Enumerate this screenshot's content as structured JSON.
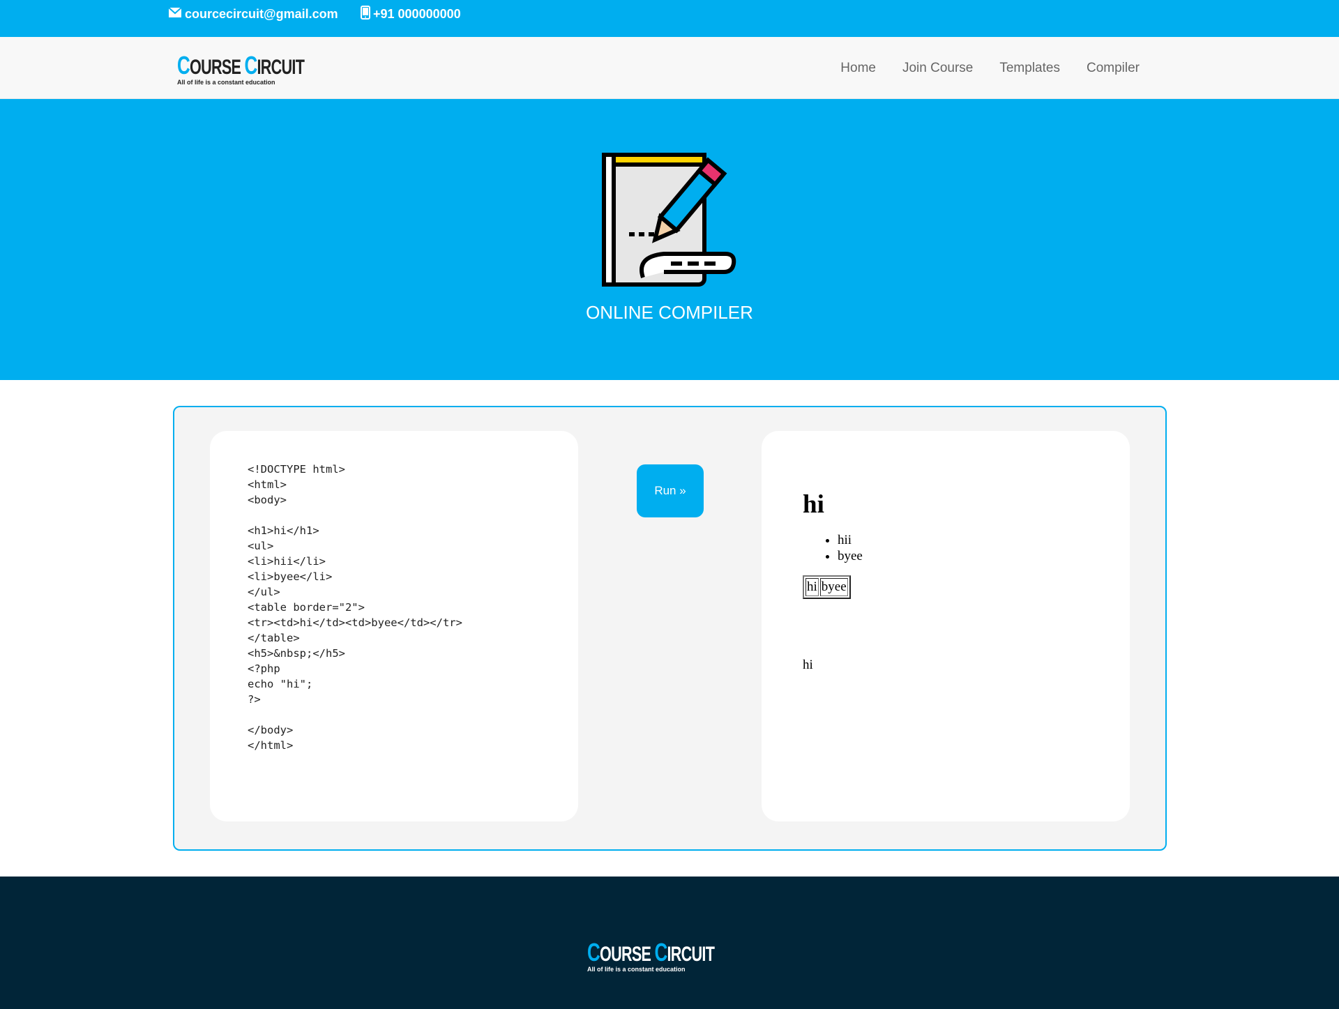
{
  "topbar": {
    "email": "courcecircuit@gmail.com",
    "phone": "+91 000000000",
    "email_icon": "envelope-icon",
    "phone_icon": "mobile-phone-icon"
  },
  "brand": {
    "title_c1": "C",
    "title_rest1": "OURSE ",
    "title_c2": "C",
    "title_rest2": "IRCUIT",
    "tagline": "All of life is a constant education"
  },
  "nav": {
    "items": [
      {
        "label": "Home"
      },
      {
        "label": "Join Course"
      },
      {
        "label": "Templates"
      },
      {
        "label": "Compiler"
      }
    ]
  },
  "hero": {
    "title": "ONLINE COMPILER",
    "icon": "notepad-pencil-icon"
  },
  "compiler": {
    "code": "<!DOCTYPE html>\n<html>\n<body>\n\n<h1>hi</h1>\n<ul>\n<li>hii</li>\n<li>byee</li>\n</ul>\n<table border=\"2\">\n<tr><td>hi</td><td>byee</td></tr>\n</table>\n<h5>&nbsp;</h5>\n<?php\necho \"hi\";\n?>\n\n</body>\n</html>",
    "run_label": "Run »",
    "output": {
      "heading": "hi",
      "list": [
        "hii",
        "byee"
      ],
      "table_cells": [
        "hi",
        "byee"
      ],
      "echo": "hi"
    }
  },
  "colors": {
    "accent": "#00aeef",
    "footer_bg": "#012538",
    "panel_bg": "#f4f4f4"
  }
}
